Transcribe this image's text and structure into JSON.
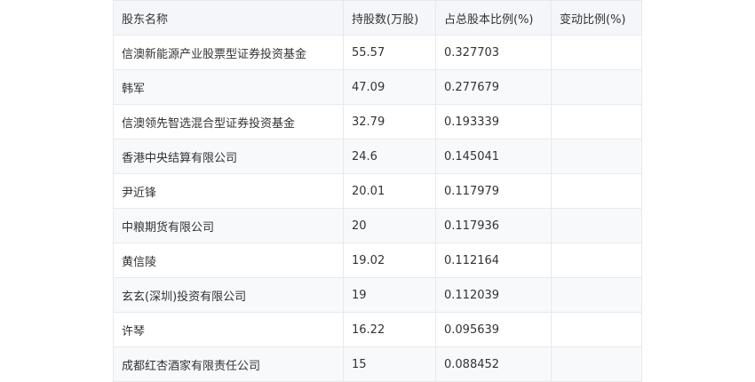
{
  "table": {
    "headers": [
      "股东名称",
      "持股数(万股)",
      "占总股本比例(%)",
      "变动比例(%)"
    ],
    "rows": [
      [
        "信澳新能源产业股票型证券投资基金",
        "55.57",
        "0.327703",
        ""
      ],
      [
        "韩军",
        "47.09",
        "0.277679",
        ""
      ],
      [
        "信澳领先智选混合型证券投资基金",
        "32.79",
        "0.193339",
        ""
      ],
      [
        "香港中央结算有限公司",
        "24.6",
        "0.145041",
        ""
      ],
      [
        "尹近锋",
        "20.01",
        "0.117979",
        ""
      ],
      [
        "中粮期货有限公司",
        "20",
        "0.117936",
        ""
      ],
      [
        "黄信陵",
        "19.02",
        "0.112164",
        ""
      ],
      [
        "玄玄(深圳)投资有限公司",
        "19",
        "0.112039",
        ""
      ],
      [
        "许琴",
        "16.22",
        "0.095639",
        ""
      ],
      [
        "成都红杏酒家有限责任公司",
        "15",
        "0.088452",
        ""
      ]
    ]
  }
}
